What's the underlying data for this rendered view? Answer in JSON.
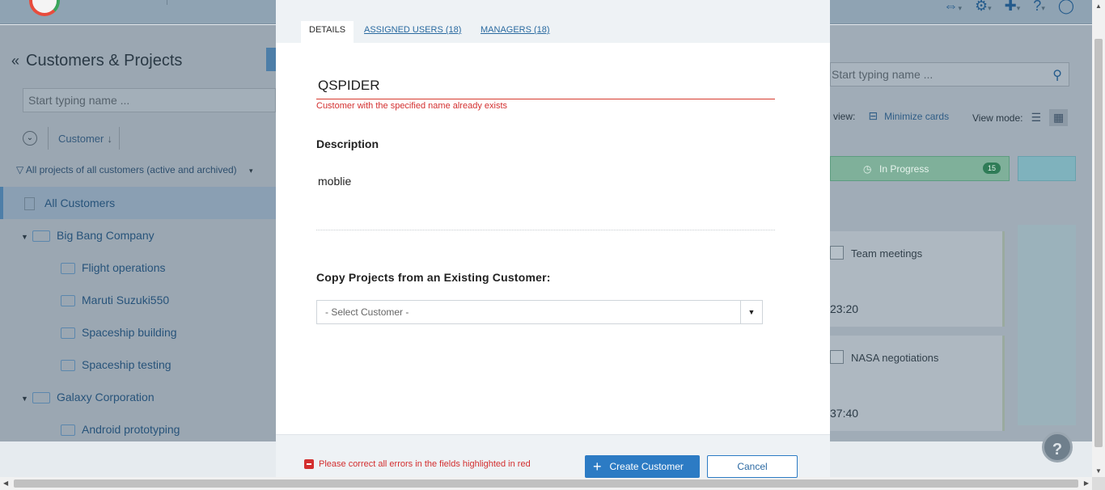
{
  "left_panel": {
    "title": "Customers & Projects",
    "collapse_icon": "double-chevron-left-icon",
    "search_placeholder": "Start typing name ...",
    "sort_label": "Customer",
    "filter_label": "All projects of all customers (active and archived)",
    "tree": [
      {
        "label": "All Customers",
        "level": 0,
        "active": true
      },
      {
        "label": "Big Bang Company",
        "level": 1
      },
      {
        "label": "Flight operations",
        "level": 2
      },
      {
        "label": "Maruti Suzuki550",
        "level": 2
      },
      {
        "label": "Spaceship building",
        "level": 2
      },
      {
        "label": "Spaceship testing",
        "level": 2
      },
      {
        "label": "Galaxy Corporation",
        "level": 1
      },
      {
        "label": "Android prototyping",
        "level": 2
      }
    ]
  },
  "right_panel": {
    "search_placeholder": "Start typing name ...",
    "view_label": "view:",
    "minimize_label": "Minimize cards",
    "view_mode_label": "View mode:",
    "status_in_progress": "In Progress",
    "status_count": "15",
    "cards": [
      {
        "title": "Team meetings",
        "time": "23:20"
      },
      {
        "title": "NASA negotiations",
        "time": "37:40"
      }
    ]
  },
  "modal": {
    "tabs": {
      "details": "DETAILS",
      "assigned_users": "ASSIGNED USERS (18)",
      "managers": "MANAGERS (18)"
    },
    "name_value": "QSPIDER",
    "name_error": "Customer with the specified name already exists",
    "description_label": "Description",
    "description_value": "moblie",
    "copy_label": "Copy Projects from an Existing Customer:",
    "select_value": "- Select Customer -",
    "footer_error": "Please correct all errors in the fields highlighted in red",
    "create_button": "Create Customer",
    "cancel_button": "Cancel"
  },
  "help_label": "?"
}
